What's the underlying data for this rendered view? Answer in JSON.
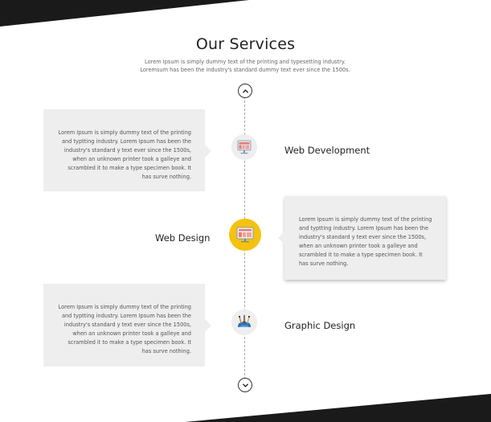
{
  "section": {
    "title": "Our Services",
    "subtitle": "Lorem Ipsum is simply dummy text of the printing and typesetting industry. Loremsum has been the industry's standard dummy text ever since the 1500s."
  },
  "timeline": {
    "up_icon": "chevron-up-icon",
    "down_icon": "chevron-down-icon",
    "items": [
      {
        "label": "Web Development",
        "icon": "web-development-icon",
        "description": "Lorem Ipsum is simply dummy text of the printing and typtting industry. Lorem Ipsum has been the industry's standard y text ever since the 1500s, when an unknown printer took a galleye and scrambled it to make a type specimen book. It has surve nothing."
      },
      {
        "label": "Web Design",
        "icon": "web-design-icon",
        "accent_color": "#f5c20f",
        "description": "Lorem Ipsum is simply dummy text of the printing and typtting industry. Lorem Ipsum has been the industry's standard y text ever since the 1500s, when an unknown printer took a galleye and scrambled it to make a type specimen book. It has surve nothing."
      },
      {
        "label": "Graphic Design",
        "icon": "graphic-design-icon",
        "description": "Lorem Ipsum is simply dummy text of the printing and typtting industry. Lorem Ipsum has been the industry's standard y text ever since the 1500s, when an unknown printer took a galleye and scrambled it to make a type specimen book. It has surve nothing."
      }
    ]
  }
}
